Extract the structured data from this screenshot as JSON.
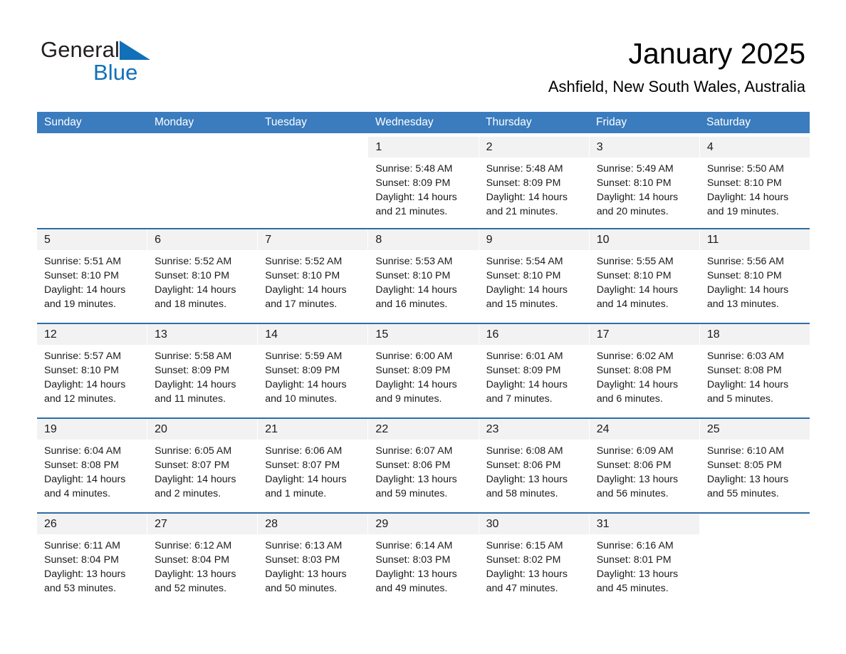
{
  "brand": {
    "name_part1": "General",
    "name_part2": "Blue",
    "triangle_color": "#1170b8",
    "text_color": "#231f20"
  },
  "header": {
    "month_title": "January 2025",
    "location": "Ashfield, New South Wales, Australia"
  },
  "theme": {
    "header_blue": "#3a7cbe",
    "row_rule_blue": "#2e6da4",
    "day_band_gray": "#f2f2f2"
  },
  "weekdays": [
    "Sunday",
    "Monday",
    "Tuesday",
    "Wednesday",
    "Thursday",
    "Friday",
    "Saturday"
  ],
  "weeks": [
    [
      {
        "day": "",
        "blank": true,
        "sunrise": "",
        "sunset": "",
        "daylight1": "",
        "daylight2": ""
      },
      {
        "day": "",
        "blank": true,
        "sunrise": "",
        "sunset": "",
        "daylight1": "",
        "daylight2": ""
      },
      {
        "day": "",
        "blank": true,
        "sunrise": "",
        "sunset": "",
        "daylight1": "",
        "daylight2": ""
      },
      {
        "day": "1",
        "sunrise": "Sunrise: 5:48 AM",
        "sunset": "Sunset: 8:09 PM",
        "daylight1": "Daylight: 14 hours",
        "daylight2": "and 21 minutes."
      },
      {
        "day": "2",
        "sunrise": "Sunrise: 5:48 AM",
        "sunset": "Sunset: 8:09 PM",
        "daylight1": "Daylight: 14 hours",
        "daylight2": "and 21 minutes."
      },
      {
        "day": "3",
        "sunrise": "Sunrise: 5:49 AM",
        "sunset": "Sunset: 8:10 PM",
        "daylight1": "Daylight: 14 hours",
        "daylight2": "and 20 minutes."
      },
      {
        "day": "4",
        "sunrise": "Sunrise: 5:50 AM",
        "sunset": "Sunset: 8:10 PM",
        "daylight1": "Daylight: 14 hours",
        "daylight2": "and 19 minutes."
      }
    ],
    [
      {
        "day": "5",
        "sunrise": "Sunrise: 5:51 AM",
        "sunset": "Sunset: 8:10 PM",
        "daylight1": "Daylight: 14 hours",
        "daylight2": "and 19 minutes."
      },
      {
        "day": "6",
        "sunrise": "Sunrise: 5:52 AM",
        "sunset": "Sunset: 8:10 PM",
        "daylight1": "Daylight: 14 hours",
        "daylight2": "and 18 minutes."
      },
      {
        "day": "7",
        "sunrise": "Sunrise: 5:52 AM",
        "sunset": "Sunset: 8:10 PM",
        "daylight1": "Daylight: 14 hours",
        "daylight2": "and 17 minutes."
      },
      {
        "day": "8",
        "sunrise": "Sunrise: 5:53 AM",
        "sunset": "Sunset: 8:10 PM",
        "daylight1": "Daylight: 14 hours",
        "daylight2": "and 16 minutes."
      },
      {
        "day": "9",
        "sunrise": "Sunrise: 5:54 AM",
        "sunset": "Sunset: 8:10 PM",
        "daylight1": "Daylight: 14 hours",
        "daylight2": "and 15 minutes."
      },
      {
        "day": "10",
        "sunrise": "Sunrise: 5:55 AM",
        "sunset": "Sunset: 8:10 PM",
        "daylight1": "Daylight: 14 hours",
        "daylight2": "and 14 minutes."
      },
      {
        "day": "11",
        "sunrise": "Sunrise: 5:56 AM",
        "sunset": "Sunset: 8:10 PM",
        "daylight1": "Daylight: 14 hours",
        "daylight2": "and 13 minutes."
      }
    ],
    [
      {
        "day": "12",
        "sunrise": "Sunrise: 5:57 AM",
        "sunset": "Sunset: 8:10 PM",
        "daylight1": "Daylight: 14 hours",
        "daylight2": "and 12 minutes."
      },
      {
        "day": "13",
        "sunrise": "Sunrise: 5:58 AM",
        "sunset": "Sunset: 8:09 PM",
        "daylight1": "Daylight: 14 hours",
        "daylight2": "and 11 minutes."
      },
      {
        "day": "14",
        "sunrise": "Sunrise: 5:59 AM",
        "sunset": "Sunset: 8:09 PM",
        "daylight1": "Daylight: 14 hours",
        "daylight2": "and 10 minutes."
      },
      {
        "day": "15",
        "sunrise": "Sunrise: 6:00 AM",
        "sunset": "Sunset: 8:09 PM",
        "daylight1": "Daylight: 14 hours",
        "daylight2": "and 9 minutes."
      },
      {
        "day": "16",
        "sunrise": "Sunrise: 6:01 AM",
        "sunset": "Sunset: 8:09 PM",
        "daylight1": "Daylight: 14 hours",
        "daylight2": "and 7 minutes."
      },
      {
        "day": "17",
        "sunrise": "Sunrise: 6:02 AM",
        "sunset": "Sunset: 8:08 PM",
        "daylight1": "Daylight: 14 hours",
        "daylight2": "and 6 minutes."
      },
      {
        "day": "18",
        "sunrise": "Sunrise: 6:03 AM",
        "sunset": "Sunset: 8:08 PM",
        "daylight1": "Daylight: 14 hours",
        "daylight2": "and 5 minutes."
      }
    ],
    [
      {
        "day": "19",
        "sunrise": "Sunrise: 6:04 AM",
        "sunset": "Sunset: 8:08 PM",
        "daylight1": "Daylight: 14 hours",
        "daylight2": "and 4 minutes."
      },
      {
        "day": "20",
        "sunrise": "Sunrise: 6:05 AM",
        "sunset": "Sunset: 8:07 PM",
        "daylight1": "Daylight: 14 hours",
        "daylight2": "and 2 minutes."
      },
      {
        "day": "21",
        "sunrise": "Sunrise: 6:06 AM",
        "sunset": "Sunset: 8:07 PM",
        "daylight1": "Daylight: 14 hours",
        "daylight2": "and 1 minute."
      },
      {
        "day": "22",
        "sunrise": "Sunrise: 6:07 AM",
        "sunset": "Sunset: 8:06 PM",
        "daylight1": "Daylight: 13 hours",
        "daylight2": "and 59 minutes."
      },
      {
        "day": "23",
        "sunrise": "Sunrise: 6:08 AM",
        "sunset": "Sunset: 8:06 PM",
        "daylight1": "Daylight: 13 hours",
        "daylight2": "and 58 minutes."
      },
      {
        "day": "24",
        "sunrise": "Sunrise: 6:09 AM",
        "sunset": "Sunset: 8:06 PM",
        "daylight1": "Daylight: 13 hours",
        "daylight2": "and 56 minutes."
      },
      {
        "day": "25",
        "sunrise": "Sunrise: 6:10 AM",
        "sunset": "Sunset: 8:05 PM",
        "daylight1": "Daylight: 13 hours",
        "daylight2": "and 55 minutes."
      }
    ],
    [
      {
        "day": "26",
        "sunrise": "Sunrise: 6:11 AM",
        "sunset": "Sunset: 8:04 PM",
        "daylight1": "Daylight: 13 hours",
        "daylight2": "and 53 minutes."
      },
      {
        "day": "27",
        "sunrise": "Sunrise: 6:12 AM",
        "sunset": "Sunset: 8:04 PM",
        "daylight1": "Daylight: 13 hours",
        "daylight2": "and 52 minutes."
      },
      {
        "day": "28",
        "sunrise": "Sunrise: 6:13 AM",
        "sunset": "Sunset: 8:03 PM",
        "daylight1": "Daylight: 13 hours",
        "daylight2": "and 50 minutes."
      },
      {
        "day": "29",
        "sunrise": "Sunrise: 6:14 AM",
        "sunset": "Sunset: 8:03 PM",
        "daylight1": "Daylight: 13 hours",
        "daylight2": "and 49 minutes."
      },
      {
        "day": "30",
        "sunrise": "Sunrise: 6:15 AM",
        "sunset": "Sunset: 8:02 PM",
        "daylight1": "Daylight: 13 hours",
        "daylight2": "and 47 minutes."
      },
      {
        "day": "31",
        "sunrise": "Sunrise: 6:16 AM",
        "sunset": "Sunset: 8:01 PM",
        "daylight1": "Daylight: 13 hours",
        "daylight2": "and 45 minutes."
      },
      {
        "day": "",
        "blank": true,
        "sunrise": "",
        "sunset": "",
        "daylight1": "",
        "daylight2": ""
      }
    ]
  ]
}
